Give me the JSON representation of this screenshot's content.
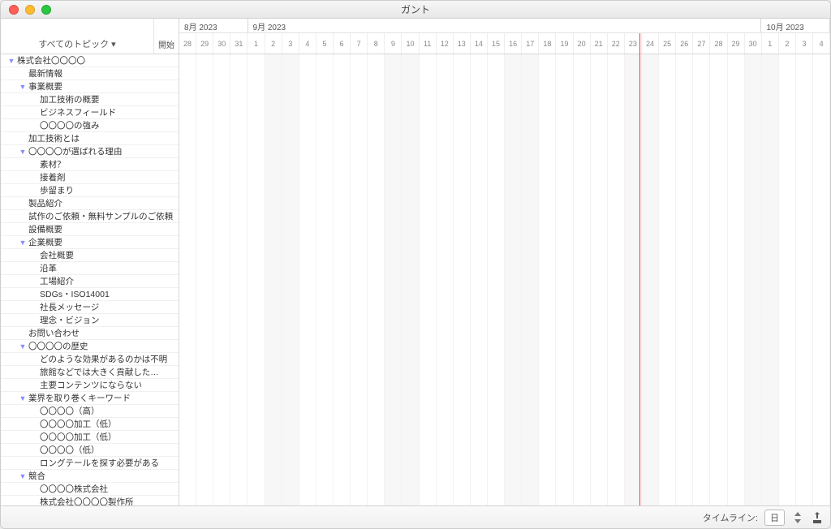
{
  "window": {
    "title": "ガント"
  },
  "sidebar": {
    "topic_selector": "すべてのトピック ▾",
    "start_header": "開始"
  },
  "tree": [
    {
      "level": 0,
      "expandable": true,
      "label": "株式会社〇〇〇〇"
    },
    {
      "level": 1,
      "expandable": false,
      "label": "最新情報"
    },
    {
      "level": 1,
      "expandable": true,
      "label": "事業概要"
    },
    {
      "level": 2,
      "expandable": false,
      "label": "加工技術の概要"
    },
    {
      "level": 2,
      "expandable": false,
      "label": "ビジネスフィールド"
    },
    {
      "level": 2,
      "expandable": false,
      "label": "〇〇〇〇の強み"
    },
    {
      "level": 1,
      "expandable": false,
      "label": "加工技術とは"
    },
    {
      "level": 1,
      "expandable": true,
      "label": "〇〇〇〇が選ばれる理由"
    },
    {
      "level": 2,
      "expandable": false,
      "label": "素材？"
    },
    {
      "level": 2,
      "expandable": false,
      "label": "接着剤"
    },
    {
      "level": 2,
      "expandable": false,
      "label": "歩留まり"
    },
    {
      "level": 1,
      "expandable": false,
      "label": "製品紹介"
    },
    {
      "level": 1,
      "expandable": false,
      "label": "試作のご依頼・無料サンプルのご依頼"
    },
    {
      "level": 1,
      "expandable": false,
      "label": "設備概要"
    },
    {
      "level": 1,
      "expandable": true,
      "label": "企業概要"
    },
    {
      "level": 2,
      "expandable": false,
      "label": "会社概要"
    },
    {
      "level": 2,
      "expandable": false,
      "label": "沿革"
    },
    {
      "level": 2,
      "expandable": false,
      "label": "工場紹介"
    },
    {
      "level": 2,
      "expandable": false,
      "label": "SDGs・ISO14001"
    },
    {
      "level": 2,
      "expandable": false,
      "label": "社長メッセージ"
    },
    {
      "level": 2,
      "expandable": false,
      "label": "理念・ビジョン"
    },
    {
      "level": 1,
      "expandable": false,
      "label": "お問い合わせ"
    },
    {
      "level": 1,
      "expandable": true,
      "label": "〇〇〇〇の歴史"
    },
    {
      "level": 2,
      "expandable": false,
      "label": "どのような効果があるのかは不明"
    },
    {
      "level": 2,
      "expandable": false,
      "label": "旅館などでは大きく貢献した…"
    },
    {
      "level": 2,
      "expandable": false,
      "label": "主要コンテンツにならない"
    },
    {
      "level": 1,
      "expandable": true,
      "label": "業界を取り巻くキーワード"
    },
    {
      "level": 2,
      "expandable": false,
      "label": "〇〇〇〇（高）"
    },
    {
      "level": 2,
      "expandable": false,
      "label": "〇〇〇〇加工（低）"
    },
    {
      "level": 2,
      "expandable": false,
      "label": "〇〇〇〇加工（低）"
    },
    {
      "level": 2,
      "expandable": false,
      "label": "〇〇〇〇（低）"
    },
    {
      "level": 2,
      "expandable": false,
      "label": "ロングテールを探す必要がある"
    },
    {
      "level": 1,
      "expandable": true,
      "label": "競合"
    },
    {
      "level": 2,
      "expandable": false,
      "label": "〇〇〇〇株式会社"
    },
    {
      "level": 2,
      "expandable": false,
      "label": "株式会社〇〇〇〇製作所"
    }
  ],
  "timeline": {
    "months": [
      {
        "label": "8月 2023",
        "span": 4
      },
      {
        "label": "9月 2023",
        "span": 30
      },
      {
        "label": "10月 2023",
        "span": 4
      }
    ],
    "days": [
      {
        "n": "28",
        "we": false
      },
      {
        "n": "29",
        "we": false
      },
      {
        "n": "30",
        "we": false
      },
      {
        "n": "31",
        "we": false
      },
      {
        "n": "1",
        "we": false
      },
      {
        "n": "2",
        "we": true
      },
      {
        "n": "3",
        "we": true
      },
      {
        "n": "4",
        "we": false
      },
      {
        "n": "5",
        "we": false
      },
      {
        "n": "6",
        "we": false
      },
      {
        "n": "7",
        "we": false
      },
      {
        "n": "8",
        "we": false
      },
      {
        "n": "9",
        "we": true
      },
      {
        "n": "10",
        "we": true
      },
      {
        "n": "11",
        "we": false
      },
      {
        "n": "12",
        "we": false
      },
      {
        "n": "13",
        "we": false
      },
      {
        "n": "14",
        "we": false
      },
      {
        "n": "15",
        "we": false
      },
      {
        "n": "16",
        "we": true
      },
      {
        "n": "17",
        "we": true
      },
      {
        "n": "18",
        "we": false
      },
      {
        "n": "19",
        "we": false
      },
      {
        "n": "20",
        "we": false
      },
      {
        "n": "21",
        "we": false
      },
      {
        "n": "22",
        "we": false
      },
      {
        "n": "23",
        "we": true
      },
      {
        "n": "24",
        "we": true
      },
      {
        "n": "25",
        "we": false
      },
      {
        "n": "26",
        "we": false
      },
      {
        "n": "27",
        "we": false
      },
      {
        "n": "28",
        "we": false
      },
      {
        "n": "29",
        "we": false
      },
      {
        "n": "30",
        "we": true
      },
      {
        "n": "1",
        "we": true
      },
      {
        "n": "2",
        "we": false
      },
      {
        "n": "3",
        "we": false
      },
      {
        "n": "4",
        "we": false
      }
    ],
    "today_index": 26
  },
  "footer": {
    "timeline_label": "タイムライン:",
    "unit": "日"
  }
}
